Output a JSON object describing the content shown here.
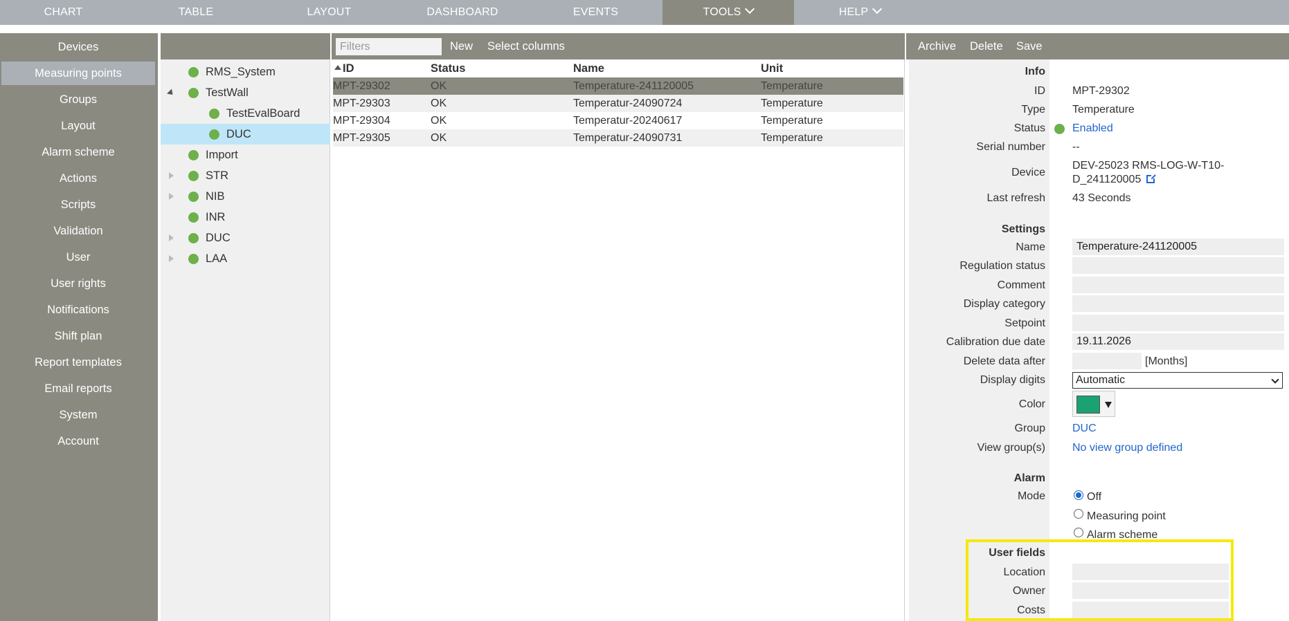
{
  "topnav": {
    "items": [
      {
        "label": "CHART"
      },
      {
        "label": "TABLE"
      },
      {
        "label": "LAYOUT"
      },
      {
        "label": "DASHBOARD"
      },
      {
        "label": "EVENTS"
      },
      {
        "label": "TOOLS"
      },
      {
        "label": "HELP"
      }
    ],
    "active": "TOOLS"
  },
  "sidebar": {
    "items": [
      {
        "label": "Devices"
      },
      {
        "label": "Measuring points"
      },
      {
        "label": "Groups"
      },
      {
        "label": "Layout"
      },
      {
        "label": "Alarm scheme"
      },
      {
        "label": "Actions"
      },
      {
        "label": "Scripts"
      },
      {
        "label": "Validation"
      },
      {
        "label": "User"
      },
      {
        "label": "User rights"
      },
      {
        "label": "Notifications"
      },
      {
        "label": "Shift plan"
      },
      {
        "label": "Report templates"
      },
      {
        "label": "Email reports"
      },
      {
        "label": "System"
      },
      {
        "label": "Account"
      }
    ],
    "active": "Measuring points"
  },
  "tree": {
    "nodes": [
      {
        "label": "RMS_System",
        "expander": "none"
      },
      {
        "label": "TestWall",
        "expander": "open"
      },
      {
        "label": "TestEvalBoard",
        "expander": "none"
      },
      {
        "label": "DUC",
        "expander": "none",
        "selected": true
      },
      {
        "label": "Import",
        "expander": "none"
      },
      {
        "label": "STR",
        "expander": "closed"
      },
      {
        "label": "NIB",
        "expander": "closed"
      },
      {
        "label": "INR",
        "expander": "none"
      },
      {
        "label": "DUC",
        "expander": "closed"
      },
      {
        "label": "LAA",
        "expander": "closed"
      }
    ]
  },
  "table": {
    "filter_placeholder": "Filters",
    "new_label": "New",
    "select_columns_label": "Select columns",
    "columns": [
      "ID",
      "Status",
      "Name",
      "Unit"
    ],
    "rows": [
      {
        "id": "MPT-29302",
        "status": "OK",
        "name": "Temperature-241120005",
        "unit": "Temperature"
      },
      {
        "id": "MPT-29303",
        "status": "OK",
        "name": "Temperatur-24090724",
        "unit": "Temperature"
      },
      {
        "id": "MPT-29304",
        "status": "OK",
        "name": "Temperatur-20240617",
        "unit": "Temperature"
      },
      {
        "id": "MPT-29305",
        "status": "OK",
        "name": "Temperatur-24090731",
        "unit": "Temperature"
      }
    ]
  },
  "detail": {
    "toolbar": {
      "archive": "Archive",
      "delete": "Delete",
      "save": "Save"
    },
    "info": {
      "heading": "Info",
      "id_label": "ID",
      "id": "MPT-29302",
      "type_label": "Type",
      "type": "Temperature",
      "status_label": "Status",
      "status": "Enabled",
      "serial_label": "Serial number",
      "serial": "--",
      "device_label": "Device",
      "device_line1": "DEV-25023 RMS-LOG-W-T10-",
      "device_line2": "D_241120005",
      "refresh_label": "Last refresh",
      "refresh": "43 Seconds"
    },
    "settings": {
      "heading": "Settings",
      "name_label": "Name",
      "name": "Temperature-241120005",
      "regulation_label": "Regulation status",
      "regulation": "",
      "comment_label": "Comment",
      "comment": "",
      "display_category_label": "Display category",
      "display_category": "",
      "setpoint_label": "Setpoint",
      "setpoint": "",
      "calibration_label": "Calibration due date",
      "calibration": "19.11.2026",
      "delete_after_label": "Delete data after",
      "delete_after": "",
      "delete_after_unit": "[Months]",
      "display_digits_label": "Display digits",
      "display_digits": "Automatic",
      "color_label": "Color",
      "color": "#1aa272",
      "group_label": "Group",
      "group": "DUC",
      "view_groups_label": "View group(s)",
      "view_groups": "No view group defined"
    },
    "alarm": {
      "heading": "Alarm",
      "mode_label": "Mode",
      "options": [
        "Off",
        "Measuring point",
        "Alarm scheme"
      ],
      "selected": "Off"
    },
    "user_fields": {
      "heading": "User fields",
      "location_label": "Location",
      "location": "",
      "owner_label": "Owner",
      "owner": "",
      "costs_label": "Costs",
      "costs": ""
    }
  }
}
